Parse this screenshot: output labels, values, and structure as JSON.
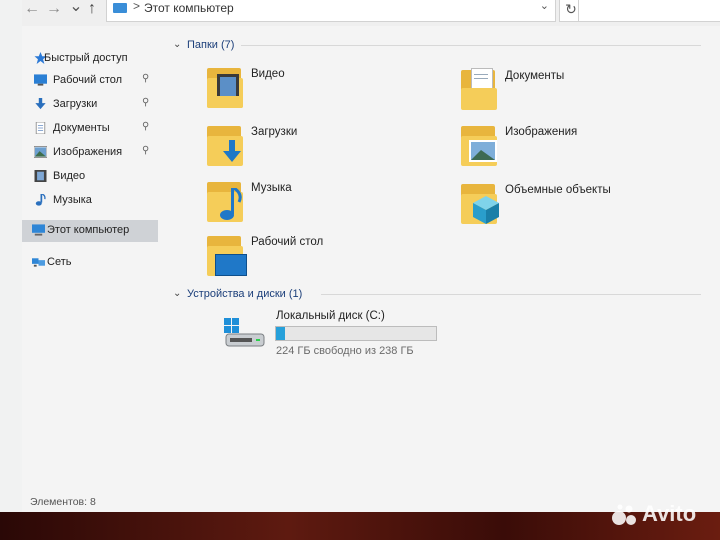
{
  "address": {
    "path_label": "Этот компьютер",
    "separator": ">"
  },
  "nav_buttons": {
    "back": "←",
    "forward": "→",
    "up": "↑",
    "dropdown": "⌄",
    "refresh": "↻"
  },
  "sidebar": {
    "quick_access": "Быстрый доступ",
    "items": [
      {
        "label": "Рабочий стол",
        "pinned": true
      },
      {
        "label": "Загрузки",
        "pinned": true
      },
      {
        "label": "Документы",
        "pinned": true
      },
      {
        "label": "Изображения",
        "pinned": true
      },
      {
        "label": "Видео",
        "pinned": false
      },
      {
        "label": "Музыка",
        "pinned": false
      }
    ],
    "this_pc": "Этот компьютер",
    "network": "Сеть",
    "pin_glyph": "📌"
  },
  "folders_group": {
    "title": "Папки (7)",
    "chevron": "⌄"
  },
  "folders": [
    {
      "label": "Видео",
      "icon": "video-folder-icon"
    },
    {
      "label": "Документы",
      "icon": "documents-folder-icon"
    },
    {
      "label": "Загрузки",
      "icon": "downloads-folder-icon"
    },
    {
      "label": "Изображения",
      "icon": "pictures-folder-icon"
    },
    {
      "label": "Музыка",
      "icon": "music-folder-icon"
    },
    {
      "label": "Объемные объекты",
      "icon": "3d-objects-folder-icon"
    },
    {
      "label": "Рабочий стол",
      "icon": "desktop-folder-icon"
    }
  ],
  "devices_group": {
    "title": "Устройства и диски (1)",
    "chevron": "⌄"
  },
  "drive": {
    "name": "Локальный диск (C:)",
    "free_text": "224 ГБ свободно из 238 ГБ",
    "used_fraction": 0.059
  },
  "status": {
    "elements": "Элементов: 8"
  },
  "watermark": {
    "text": "Avito"
  },
  "colors": {
    "accent": "#26a0da",
    "folder": "#f5cd59",
    "group_header": "#1c3f7a",
    "selected": "#cfd2d6"
  }
}
